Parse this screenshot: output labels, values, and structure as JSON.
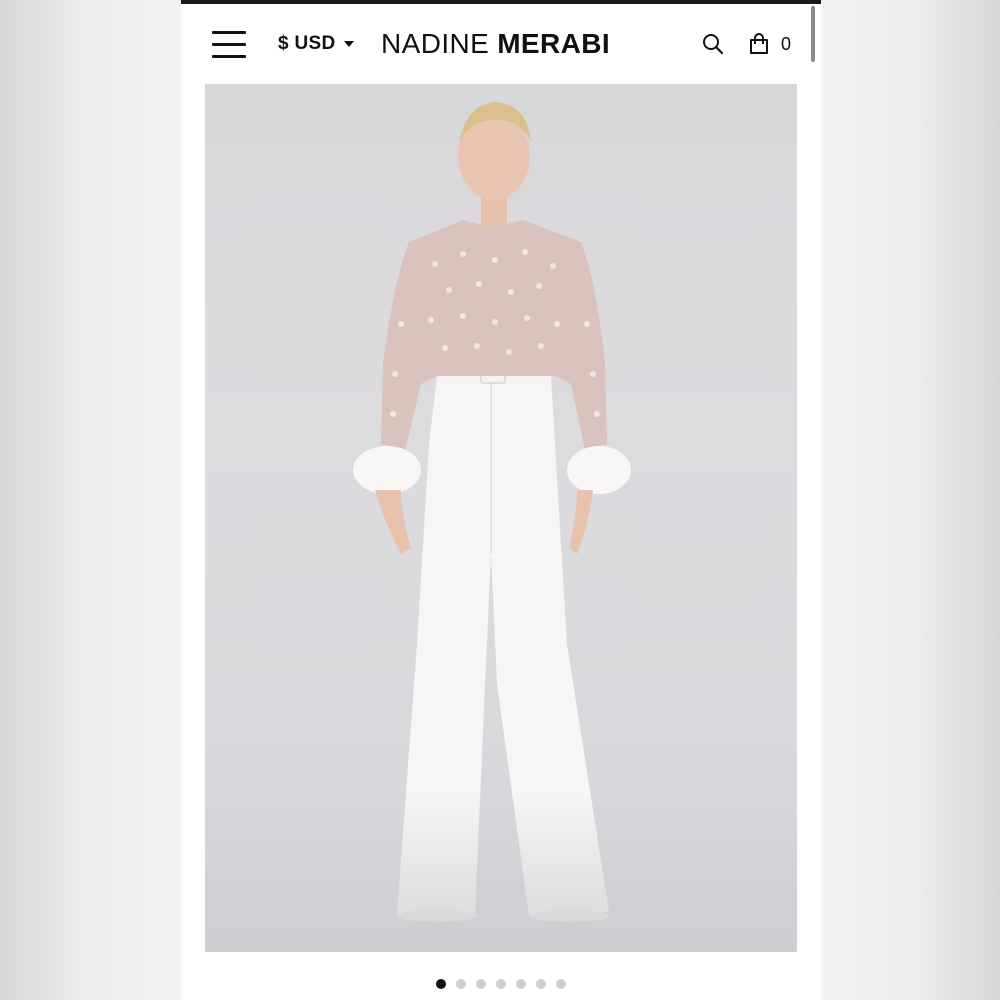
{
  "header": {
    "currency_label": "$ USD",
    "brand_light": "NADINE",
    "brand_bold": "MERABI",
    "cart_count": "0"
  },
  "icons": {
    "menu": "hamburger-icon",
    "currency_caret": "chevron-down-icon",
    "search": "search-icon",
    "cart": "bag-icon"
  },
  "carousel": {
    "slide_count": 7,
    "active_index": 0
  },
  "colors": {
    "text": "#111111",
    "dot_active": "#111111",
    "dot_inactive": "#cfcfcf",
    "image_bg": "#d9d8db"
  }
}
